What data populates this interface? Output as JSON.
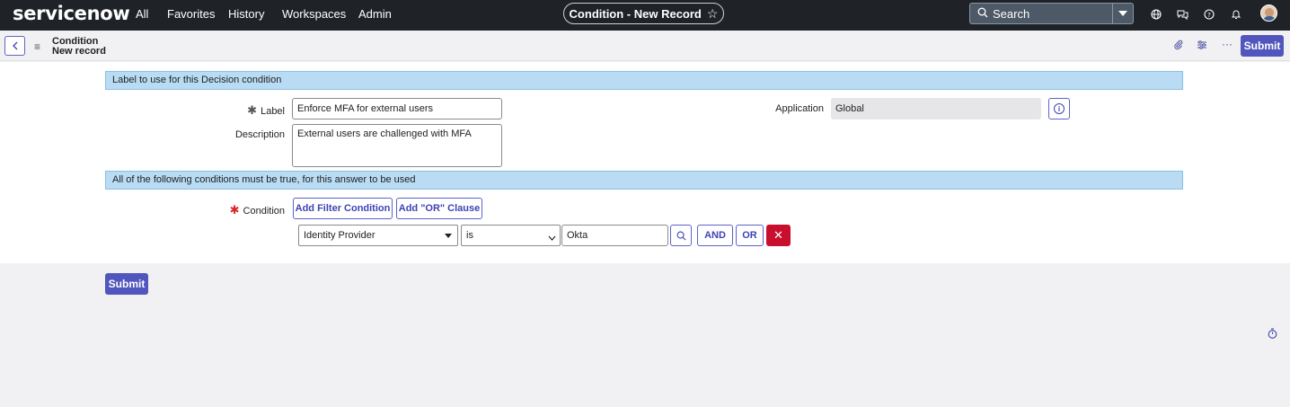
{
  "topnav": {
    "logo": "servicenow",
    "items": [
      "All",
      "Favorites",
      "History",
      "Workspaces",
      "Admin"
    ],
    "title": "Condition - New Record",
    "search_placeholder": "Search",
    "icons": [
      "globe-icon",
      "chat-icon",
      "help-icon",
      "bell-icon",
      "avatar"
    ]
  },
  "formbar": {
    "crumb_title": "Condition",
    "crumb_sub": "New record",
    "submit_label": "Submit",
    "icons": [
      "attachment-icon",
      "settings-icon",
      "more-icon"
    ]
  },
  "section1": {
    "title": "Label to use for this Decision condition"
  },
  "fields": {
    "label_label": "Label",
    "label_value": "Enforce MFA for external users",
    "description_label": "Description",
    "description_value": "External users are challenged with MFA",
    "application_label": "Application",
    "application_value": "Global"
  },
  "section2": {
    "title": "All of the following conditions must be true, for this answer to be used"
  },
  "condition": {
    "label": "Condition",
    "add_filter_label": "Add Filter Condition",
    "add_or_label": "Add \"OR\" Clause",
    "field_value": "Identity Provider",
    "operator_value": "is",
    "value": "Okta",
    "and_label": "AND",
    "or_label": "OR"
  },
  "footer": {
    "submit_label": "Submit"
  },
  "colors": {
    "nav_bg": "#1f2328",
    "accent": "#5156be",
    "section_bg": "#b9dcf4",
    "delete": "#c8102e"
  }
}
